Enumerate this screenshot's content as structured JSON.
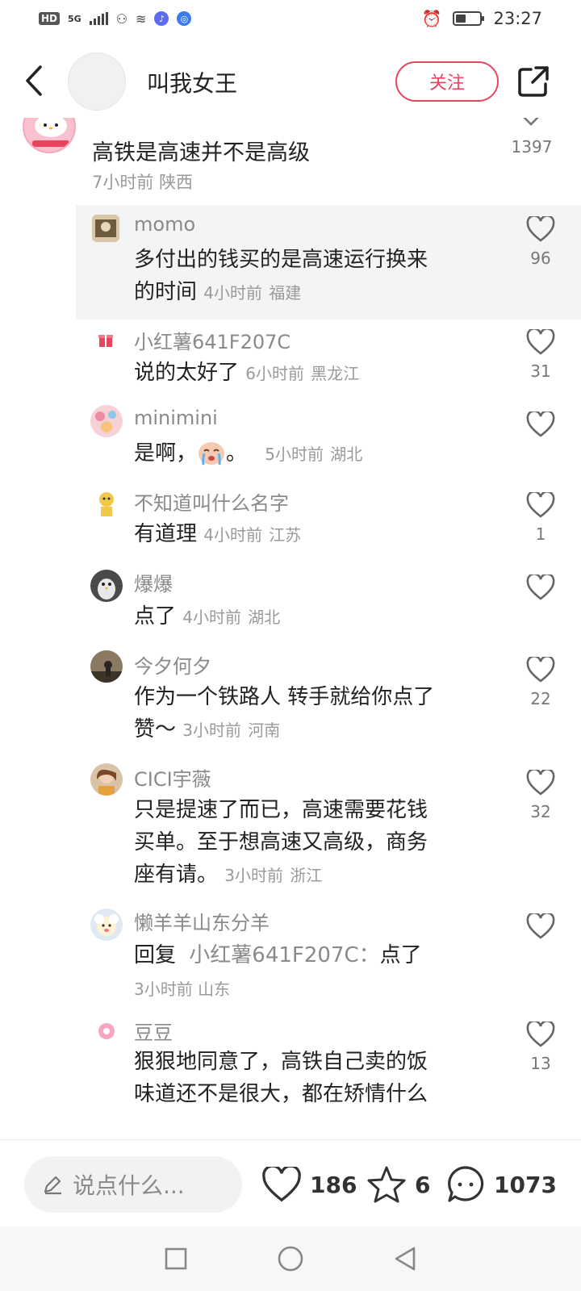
{
  "status_bar": {
    "hd_badge": "HD",
    "network": "5G",
    "time": "23:27"
  },
  "header": {
    "author_name": "叫我女王",
    "follow_label": "关注"
  },
  "top_comment": {
    "text": "高铁是高速并不是高级",
    "time": "7小时前",
    "location": "陕西",
    "likes": "1397"
  },
  "replies": [
    {
      "username": "momo",
      "text_line1": "多付出的钱买的是高速运行换来",
      "text_line2": "的时间",
      "time": "4小时前",
      "location": "福建",
      "likes": "96"
    },
    {
      "username": "小红薯641F207C",
      "text": "说的太好了",
      "time": "6小时前",
      "location": "黑龙江",
      "likes": "31"
    },
    {
      "username": "minimini",
      "text_before": "是啊，",
      "text_after": "。",
      "time": "5小时前",
      "location": "湖北",
      "likes": ""
    },
    {
      "username": "不知道叫什么名字",
      "text": "有道理",
      "time": "4小时前",
      "location": "江苏",
      "likes": "1"
    },
    {
      "username": "爆爆",
      "text": "点了",
      "time": "4小时前",
      "location": "湖北",
      "likes": ""
    },
    {
      "username": "今夕何夕",
      "text_line1": "作为一个铁路人 转手就给你点了",
      "text_line2": "赞～",
      "time": "3小时前",
      "location": "河南",
      "likes": "22"
    },
    {
      "username": "CICI宇薇",
      "text_line1": "只是提速了而已，高速需要花钱",
      "text_line2": "买单。至于想高速又高级，商务",
      "text_line3": "座有请。",
      "time": "3小时前",
      "location": "浙江",
      "likes": "32"
    },
    {
      "username": "懒羊羊山东分羊",
      "reply_prefix": "回复",
      "reply_to": "小红薯641F207C：",
      "text": "点了",
      "time": "3小时前",
      "location": "山东",
      "likes": ""
    },
    {
      "username": "豆豆",
      "text_line1": "狠狠地同意了，高铁自己卖的饭",
      "text_line2": "味道还不是很大，都在矫情什么",
      "likes": "13"
    }
  ],
  "bottom_bar": {
    "input_placeholder": "说点什么...",
    "like_count": "186",
    "star_count": "6",
    "comment_count": "1073"
  },
  "colors": {
    "accent": "#e8455c",
    "muted_text": "#8a8a8a",
    "highlight_bg": "#f4f4f4"
  }
}
